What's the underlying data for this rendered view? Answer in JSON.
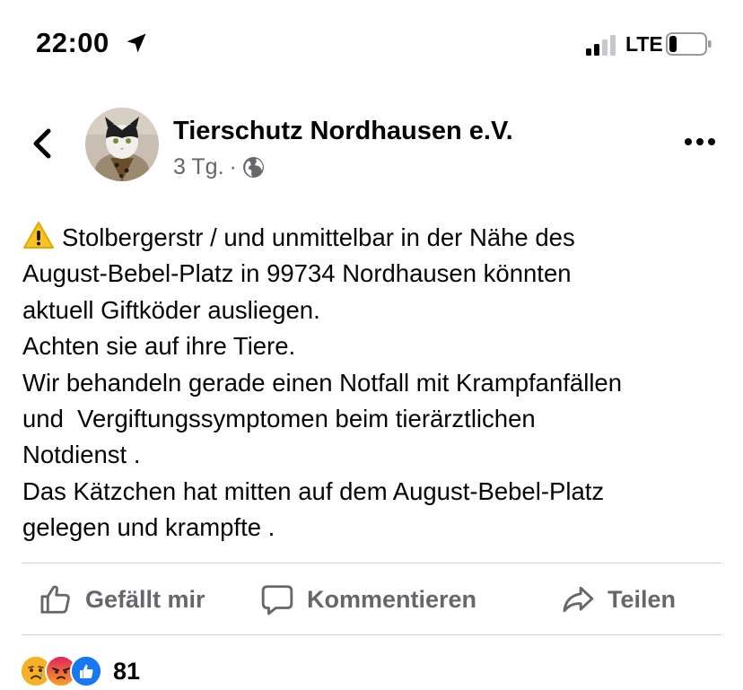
{
  "status_bar": {
    "time": "22:00",
    "network": "LTE"
  },
  "post": {
    "page_name": "Tierschutz Nordhausen e.V.",
    "age": "3 Tg.",
    "separator": "·",
    "privacy_icon": "globe-icon",
    "text_lines": [
      "Stolbergerstr / und unmittelbar in der Nähe des",
      "August-Bebel-Platz in 99734 Nordhausen könnten",
      "aktuell Giftköder ausliegen.",
      "Achten sie auf ihre Tiere.",
      "Wir behandeln gerade einen Notfall mit Krampfanfällen",
      "und  Vergiftungssymptomen beim tierärztlichen",
      "Notdienst .",
      "Das Kätzchen hat mitten auf dem August-Bebel-Platz",
      "gelegen und krampfte ."
    ]
  },
  "actions": {
    "like_label": "Gefällt mir",
    "comment_label": "Kommentieren",
    "share_label": "Teilen"
  },
  "reactions": {
    "icons": [
      "sad-reaction-icon",
      "angry-reaction-icon",
      "like-reaction-icon"
    ],
    "count": "81"
  },
  "colors": {
    "secondary_text": "#65676b",
    "divider": "#ced0d4",
    "like_blue": "#1877f2",
    "angry_orange": "#e9710f",
    "sad_yellow": "#f7b125"
  }
}
